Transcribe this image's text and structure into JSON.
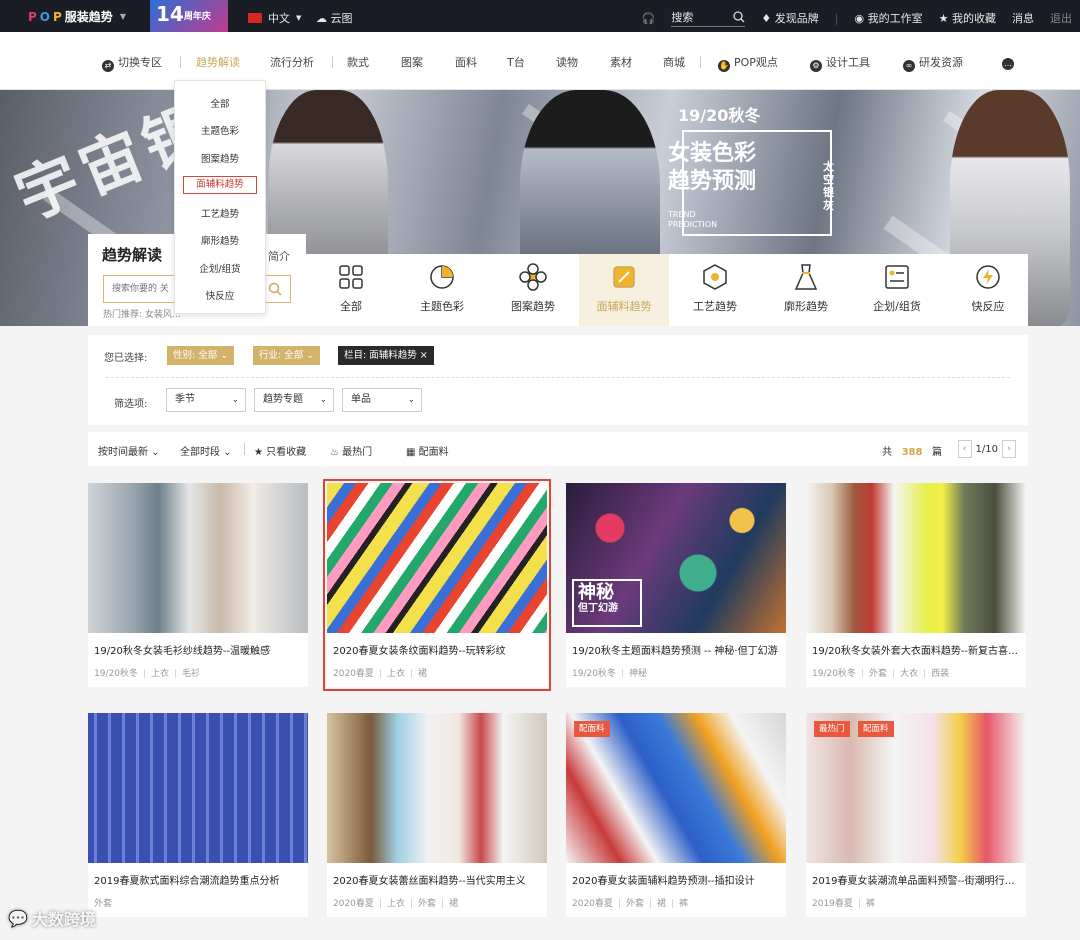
{
  "topbar": {
    "logo_text": "服装趋势",
    "anniversary_number": "14",
    "anniversary_text": "周年庆",
    "language": "中文",
    "cloud_label": "云图",
    "search_label": "搜索",
    "discover_brands": "发现品牌",
    "workspace": "我的工作室",
    "favorites": "我的收藏",
    "messages": "消息",
    "logout": "退出"
  },
  "nav": {
    "switch_zone": "切换专区",
    "items": [
      "趋势解读",
      "流行分析",
      "款式",
      "图案",
      "面料",
      "T台",
      "读物",
      "素材",
      "商城",
      "POP观点",
      "设计工具",
      "研发资源"
    ]
  },
  "dropdown": {
    "items": [
      "全部",
      "主题色彩",
      "图案趋势",
      "面辅料趋势",
      "工艺趋势",
      "廓形趋势",
      "企划/组货",
      "快反应"
    ],
    "active_index": 3
  },
  "hero": {
    "big_text": "宇宙银",
    "season": "19/20秋冬",
    "headline_1": "女装色彩",
    "headline_2": "趋势预测",
    "tagline": "太空银灰",
    "trend_1": "TREND",
    "trend_2": "PREDICTION"
  },
  "trend_panel": {
    "title": "趋势解读",
    "intro": "简介",
    "search_placeholder": "搜索你要的 关",
    "hot": "热门推荐: 女装风…"
  },
  "categories": {
    "items": [
      "全部",
      "主题色彩",
      "图案趋势",
      "面辅料趋势",
      "工艺趋势",
      "廓形趋势",
      "企划/组货",
      "快反应"
    ],
    "active_index": 3
  },
  "filter": {
    "selected_label": "您已选择:",
    "chips": [
      "性别: 全部",
      "行业: 全部",
      "栏目: 面辅料趋势"
    ],
    "filter_label": "筛选项:",
    "selects": [
      "季节",
      "趋势专题",
      "单品"
    ]
  },
  "sortbar": {
    "sort": "按时间最新",
    "period": "全部时段",
    "only_fav": "只看收藏",
    "hottest": "最热门",
    "fabric": "配面料",
    "total_prefix": "共",
    "total_count": "388",
    "total_suffix": "篇",
    "page": "1/10"
  },
  "cards": [
    {
      "title": "19/20秋冬女装毛衫纱线趋势--温暖触感",
      "tags": [
        "19/20秋冬",
        "上衣",
        "毛衫"
      ],
      "badges": []
    },
    {
      "title": "2020春夏女装条纹面料趋势--玩转彩纹",
      "tags": [
        "2020春夏",
        "上衣",
        "裙"
      ],
      "badges": []
    },
    {
      "title": "19/20秋冬主题面料趋势预测 -- 神秘·但丁幻游",
      "tags": [
        "19/20秋冬",
        "神秘"
      ],
      "badges": [],
      "overlay": "神秘",
      "overlay_sub": "但丁幻游"
    },
    {
      "title": "19/20秋冬女装外套大衣面料趋势--新复古喜…",
      "tags": [
        "19/20秋冬",
        "外套",
        "大衣",
        "西装"
      ],
      "badges": []
    },
    {
      "title": "2019春夏款式面料综合潮流趋势重点分析",
      "tags": [
        "外套"
      ],
      "badges": []
    },
    {
      "title": "2020春夏女装蕾丝面料趋势--当代实用主义",
      "tags": [
        "2020春夏",
        "上衣",
        "外套",
        "裙"
      ],
      "badges": []
    },
    {
      "title": "2020春夏女装面辅料趋势预测--插扣设计",
      "tags": [
        "2020春夏",
        "外套",
        "裙",
        "裤"
      ],
      "badges": [
        "配面料"
      ]
    },
    {
      "title": "2019春夏女装潮流单品面料预警--街潮明行…",
      "tags": [
        "2019春夏",
        "裤"
      ],
      "badges": [
        "最热门",
        "配面料"
      ]
    }
  ],
  "watermark": "大数跨境",
  "colors": {
    "gold": "#d3b36a",
    "dark": "#1a1d25",
    "accent_red": "#d9453b"
  }
}
